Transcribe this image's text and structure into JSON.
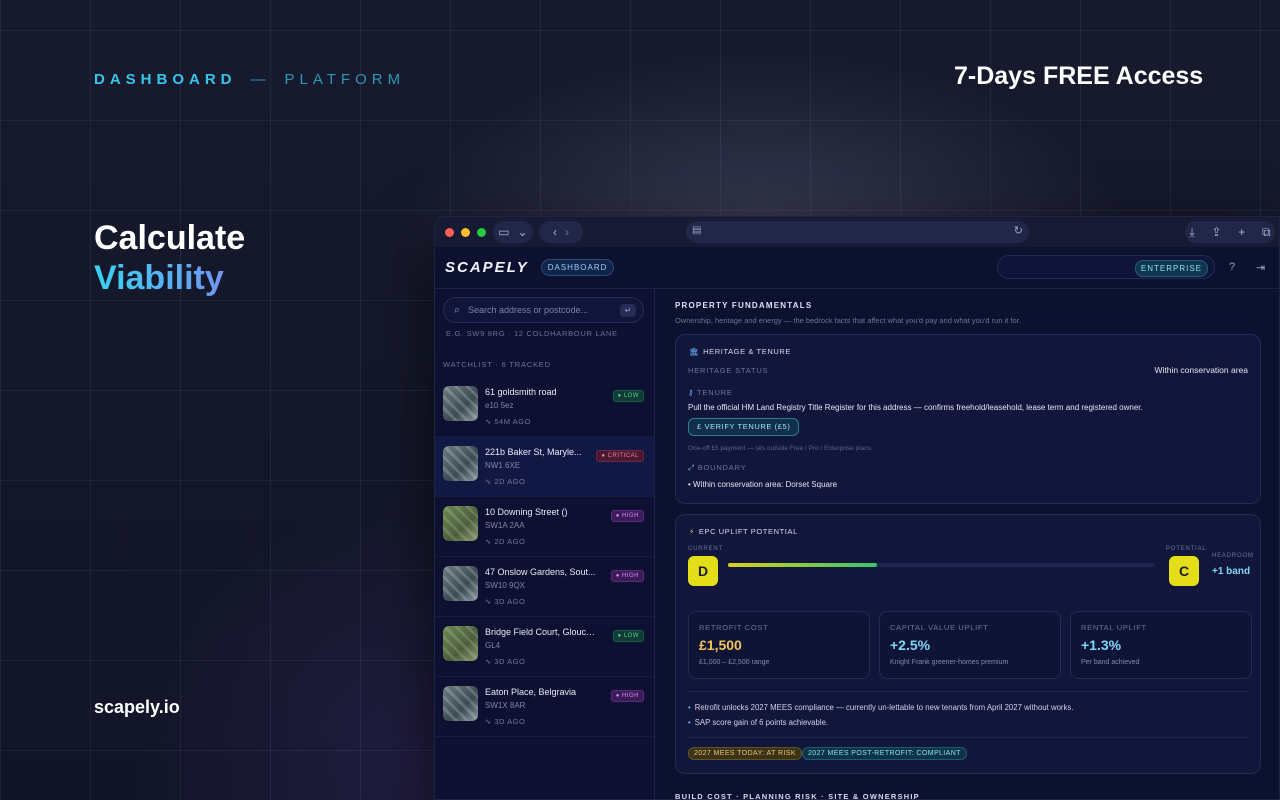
{
  "promo": {
    "brand_primary": "DASHBOARD",
    "brand_separator": "—",
    "brand_secondary": "PLATFORM",
    "trial": "7-Days FREE Access",
    "hero_line1": "Calculate",
    "hero_line2": "Viability",
    "site": "scapely.io"
  },
  "app": {
    "logo": "SCAPELY",
    "nav_pill": "DASHBOARD",
    "plan_pill": "ENTERPRISE"
  },
  "sidebar": {
    "search_placeholder": "Search address or postcode...",
    "example": "E.G. SW9 8RG · 12 COLDHARBOUR LANE",
    "watchlist_label": "WATCHLIST · 6 TRACKED",
    "items": [
      {
        "name": "61 goldsmith road",
        "postcode": "e10 5ez",
        "ago": "54M AGO",
        "risk": "LOW"
      },
      {
        "name": "221b Baker St, Maryle...",
        "postcode": "NW1 6XE",
        "ago": "2D AGO",
        "risk": "CRITICAL"
      },
      {
        "name": "10 Downing Street ()",
        "postcode": "SW1A 2AA",
        "ago": "2D AGO",
        "risk": "HIGH"
      },
      {
        "name": "47 Onslow Gardens, Sout...",
        "postcode": "SW10 9QX",
        "ago": "3D AGO",
        "risk": "HIGH"
      },
      {
        "name": "Bridge Field Court, Glouce...",
        "postcode": "GL4",
        "ago": "3D AGO",
        "risk": "LOW"
      },
      {
        "name": "Eaton Place, Belgravia",
        "postcode": "SW1X 8AR",
        "ago": "3D AGO",
        "risk": "HIGH"
      }
    ]
  },
  "main": {
    "title": "PROPERTY FUNDAMENTALS",
    "subtitle": "Ownership, heritage and energy — the bedrock facts that affect what you'd pay and what you'd run it for.",
    "heritage": {
      "title": "HERITAGE & TENURE",
      "status_label": "HERITAGE STATUS",
      "status_value": "Within conservation area",
      "tenure_label": "TENURE",
      "tenure_text": "Pull the official HM Land Registry Title Register for this address — confirms freehold/leasehold, lease term and registered owner.",
      "verify_button": "£ VERIFY TENURE (£5)",
      "fine_print": "One-off £5 payment — sits outside Free / Pro / Enterprise plans.",
      "boundary_label": "BOUNDARY",
      "boundary_text": "• Within conservation area: Dorset Square"
    },
    "epc": {
      "title": "EPC UPLIFT POTENTIAL",
      "current_label": "CURRENT",
      "current_grade": "D",
      "potential_label": "POTENTIAL",
      "potential_grade": "C",
      "headroom_label": "HEADROOM",
      "headroom_value": "+1 band",
      "progress": 0.35,
      "retrofit_label": "RETROFIT COST",
      "retrofit_value": "£1,500",
      "retrofit_desc": "£1,000 – £2,500 range",
      "capital_label": "CAPITAL VALUE UPLIFT",
      "capital_value": "+2.5%",
      "capital_desc": "Knight Frank greener-homes premium",
      "rental_label": "RENTAL UPLIFT",
      "rental_value": "+1.3%",
      "rental_desc": "Per band achieved",
      "note1": "Retrofit unlocks 2027 MEES compliance — currently un-lettable to new tenants from April 2027 without works.",
      "note2": "SAP score gain of 6 points achievable.",
      "tag1": "2027 MEES TODAY: AT RISK",
      "tag2": "2027 MEES POST-RETROFIT: COMPLIANT"
    },
    "next_section": "BUILD COST · PLANNING RISK · SITE & OWNERSHIP"
  },
  "colors": {
    "accent": "#36c6e8",
    "grade": "#e4de18",
    "retrofit": "#f2c45a",
    "uplift": "#7fd6f5"
  }
}
